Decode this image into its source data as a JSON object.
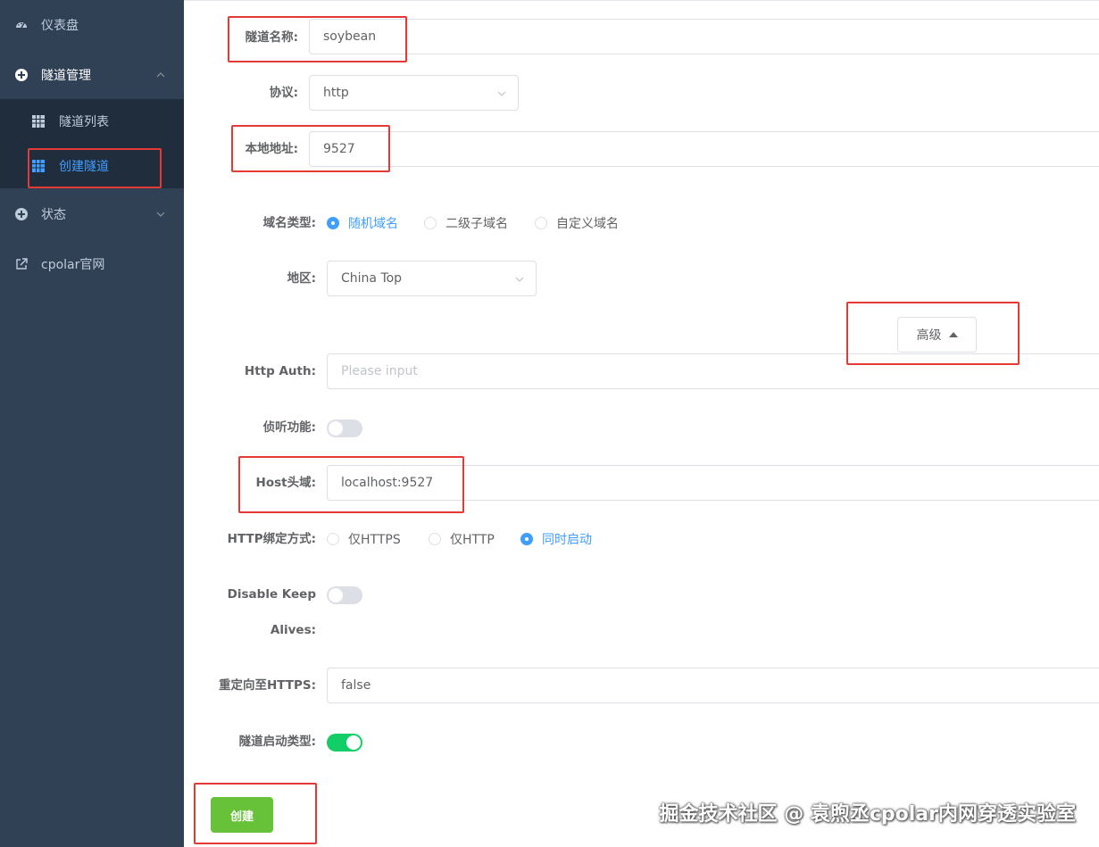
{
  "sidebar": {
    "items": [
      {
        "label": "仪表盘",
        "icon": "dashboard-icon"
      },
      {
        "label": "隧道管理",
        "icon": "tunnel-manage-icon",
        "expanded": true
      },
      {
        "label": "状态",
        "icon": "status-icon",
        "expanded": false
      },
      {
        "label": "cpolar官网",
        "icon": "external-link-icon"
      }
    ],
    "submenu": [
      {
        "label": "隧道列表",
        "icon": "table-icon"
      },
      {
        "label": "创建隧道",
        "icon": "table-icon",
        "active": true
      }
    ]
  },
  "form": {
    "tunnel_name": {
      "label": "隧道名称:",
      "value": "soybean"
    },
    "protocol": {
      "label": "协议:",
      "value": "http"
    },
    "local_address": {
      "label": "本地地址:",
      "value": "9527"
    },
    "domain_type": {
      "label": "域名类型:",
      "options": [
        "随机域名",
        "二级子域名",
        "自定义域名"
      ],
      "selected": "随机域名"
    },
    "region": {
      "label": "地区:",
      "value": "China Top"
    },
    "advanced_label": "高级",
    "http_auth": {
      "label": "Http Auth:",
      "placeholder": "Please input"
    },
    "listen": {
      "label": "侦听功能:",
      "on": false
    },
    "host_header": {
      "label": "Host头域:",
      "value": "localhost:9527"
    },
    "http_bind": {
      "label": "HTTP绑定方式:",
      "options": [
        "仅HTTPS",
        "仅HTTP",
        "同时启动"
      ],
      "selected": "同时启动"
    },
    "disable_keep_alives": {
      "label_line1": "Disable Keep",
      "label_line2": "Alives:",
      "on": false
    },
    "redirect_https": {
      "label": "重定向至HTTPS:",
      "value": "false"
    },
    "start_type": {
      "label": "隧道启动类型:",
      "on": true
    },
    "create_label": "创建"
  },
  "watermark": "掘金技术社区 @ 袁煦丞cpolar内网穿透实验室",
  "colors": {
    "sidebar_bg": "#304156",
    "submenu_bg": "#1f2d3d",
    "accent": "#409eff",
    "success": "#67c23a",
    "switch_on": "#13ce66",
    "highlight": "#e53935"
  }
}
